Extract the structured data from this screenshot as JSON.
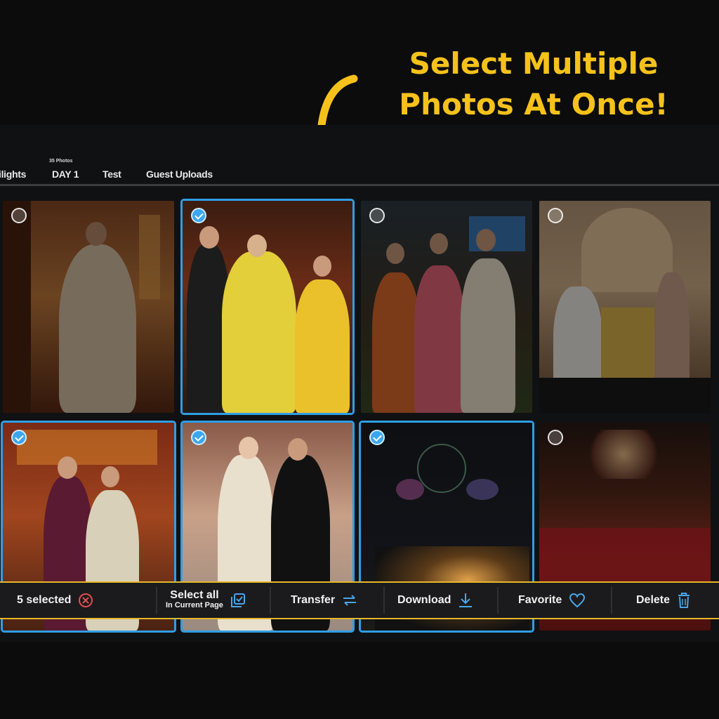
{
  "headline": {
    "line1": "Select Multiple",
    "line2": "Photos At Once!"
  },
  "tabs": [
    {
      "label": "ilights"
    },
    {
      "label": "DAY 1",
      "count": "35 Photos"
    },
    {
      "label": "Test"
    },
    {
      "label": "Guest Uploads"
    }
  ],
  "photos": [
    {
      "selected": false
    },
    {
      "selected": true
    },
    {
      "selected": false
    },
    {
      "selected": false
    },
    {
      "selected": true
    },
    {
      "selected": true
    },
    {
      "selected": true
    },
    {
      "selected": false
    }
  ],
  "toolbar": {
    "selected_count": "5 selected",
    "select_all": "Select all",
    "select_all_sub": "In Current Page",
    "transfer": "Transfer",
    "download": "Download",
    "favorite": "Favorite",
    "delete": "Delete"
  },
  "colors": {
    "accent": "#f5c21b",
    "selection": "#2f9ee6",
    "clear": "#e05050"
  },
  "icons": [
    "curved-arrow-icon",
    "clear-selection-icon",
    "select-all-icon",
    "transfer-icon",
    "download-icon",
    "heart-icon",
    "trash-icon",
    "checkmark-icon"
  ]
}
